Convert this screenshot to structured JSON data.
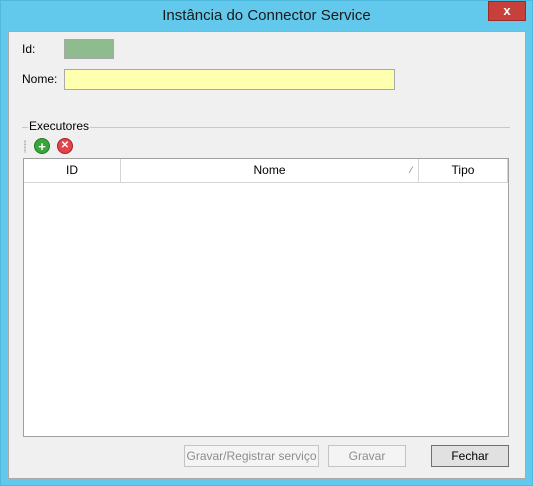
{
  "window": {
    "title": "Instância do Connector Service",
    "close_label": "x"
  },
  "form": {
    "id_label": "Id:",
    "id_value": "",
    "name_label": "Nome:",
    "name_value": ""
  },
  "executors": {
    "group_title": "Executores",
    "toolbar": {
      "add_icon": "add-icon",
      "remove_icon": "remove-icon"
    },
    "columns": [
      "ID",
      "Nome",
      "Tipo"
    ],
    "sort_indicator": "⁄",
    "rows": []
  },
  "buttons": {
    "save_register_label": "Gravar/Registrar serviço",
    "save_label": "Gravar",
    "close_label": "Fechar"
  },
  "colors": {
    "title_bar": "#62c9ec",
    "id_box": "#8fbc8f",
    "name_input": "#ffffb0",
    "close_button": "#c7403a"
  }
}
